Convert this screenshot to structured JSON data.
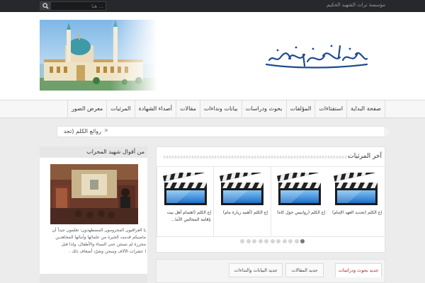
{
  "topbar": {
    "site_name": "مؤسسة تراث الشهيد الحكيم",
    "search_placeholder": "هنا ...",
    "search_icon": "search-icon"
  },
  "nav": {
    "items": [
      "صفحة البداية",
      "استفتاءات",
      "المؤلفات",
      "بحوث ودراسات",
      "بيانات ونداءات",
      "مقالات",
      "أصداء الشهادة",
      "المرثيات",
      "معرض الصور"
    ]
  },
  "ticker": {
    "label": "روائع الكلم  (تجد",
    "chevron": "»"
  },
  "sidebar": {
    "title": "من أقوال شهيد المحراب",
    "quote_lines": [
      "يا العراقيون المحرومون المضطهدون: تعلمون جيداً أن",
      "ماضيكم قدمت الخيرة من علمائها وأبنائها المجاهدين",
      "مجزرة لم تستثن حتى النساء والأطفال، ولذا قبل",
      "ا عشرات الآلاف وسجن وشرّد أضعاف ذلك ."
    ]
  },
  "elegies": {
    "title": "آخر المرثيات",
    "items": [
      {
        "title": "إع الكلم (تجديد العهد الإمام)"
      },
      {
        "title": "إع الكلم (روانيس حول كاه)"
      },
      {
        "title": "إع الكلم (أهنيه زيارة مام)"
      },
      {
        "title": "إع الكلم (اهتمام أهل بيت بإقامة المجالس الأما..."
      }
    ],
    "page_count": 11,
    "active_page": 11
  },
  "tabs": {
    "items": [
      {
        "label": "جديد بحوث ودراسات",
        "active": true
      },
      {
        "label": "جديد المقالات",
        "active": false
      },
      {
        "label": "جديد البيانات والنداءات",
        "active": false
      }
    ]
  },
  "colors": {
    "topbar": "#26282b",
    "accent": "#b02020",
    "logo": "#1f4a8f"
  }
}
